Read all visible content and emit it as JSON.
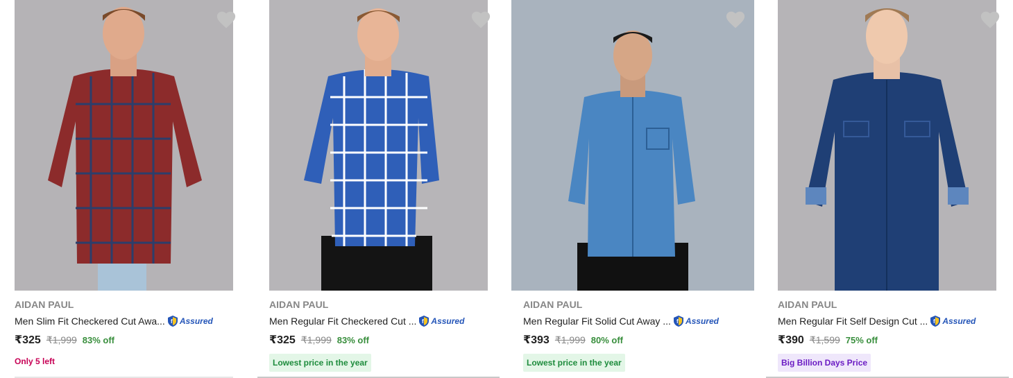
{
  "products": [
    {
      "brand": "AIDAN PAUL",
      "title": "Men Slim Fit Checkered Cut Awa...",
      "assured_label": "Assured",
      "price": "₹325",
      "mrp": "₹1,999",
      "discount": "83% off",
      "tag": "Only 5 left",
      "tag_style": "stock",
      "bg_color": "#b5b3b6",
      "shirt_color": "#8c2b2b"
    },
    {
      "brand": "AIDAN PAUL",
      "title": "Men Regular Fit Checkered Cut ...",
      "assured_label": "Assured",
      "price": "₹325",
      "mrp": "₹1,999",
      "discount": "83% off",
      "tag": "Lowest price in the year",
      "tag_style": "green",
      "bg_color": "#b7b5b8",
      "shirt_color": "#2f5fb8"
    },
    {
      "brand": "AIDAN PAUL",
      "title": "Men Regular Fit Solid Cut Away ...",
      "assured_label": "Assured",
      "price": "₹393",
      "mrp": "₹1,999",
      "discount": "80% off",
      "tag": "Lowest price in the year",
      "tag_style": "green",
      "bg_color": "#a9b3be",
      "shirt_color": "#4a86c2"
    },
    {
      "brand": "AIDAN PAUL",
      "title": "Men Regular Fit Self Design Cut ...",
      "assured_label": "Assured",
      "price": "₹390",
      "mrp": "₹1,599",
      "discount": "75% off",
      "tag": "Big Billion Days Price",
      "tag_style": "purple",
      "bg_color": "#b6b4b7",
      "shirt_color": "#1f3f75"
    }
  ],
  "icons": {
    "wishlist": "heart-icon",
    "assured": "flipkart-assured-icon"
  },
  "colors": {
    "discount": "#388e3c",
    "heart": "#c2c2c2",
    "stock_tag": "#c70055"
  }
}
